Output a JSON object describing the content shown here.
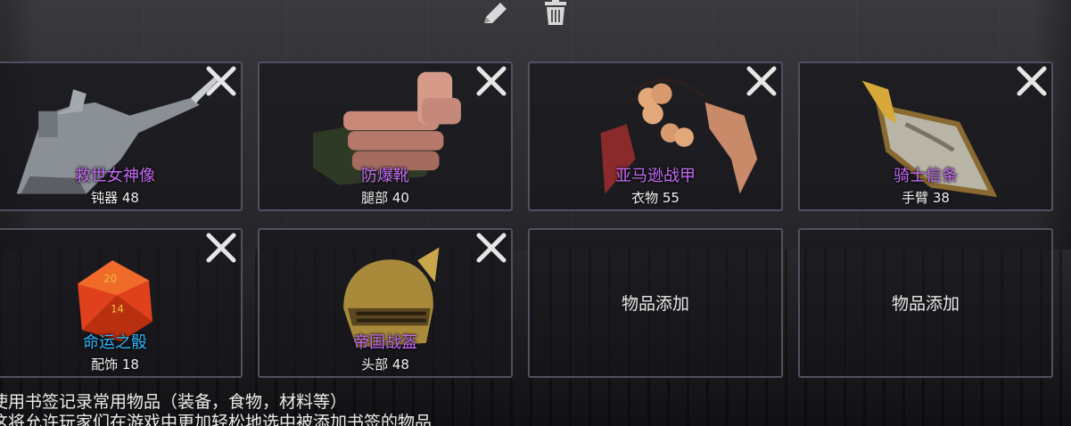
{
  "toolbar": {
    "edit_icon": "pencil-icon",
    "delete_icon": "trash-icon"
  },
  "slots": [
    {
      "name": "救世女神像",
      "stat": "钝器 48",
      "name_color": "#c46bf5",
      "icon": "goddess-statue-icon"
    },
    {
      "name": "防爆靴",
      "stat": "腿部 40",
      "name_color": "#c46bf5",
      "icon": "boots-icon"
    },
    {
      "name": "亚马逊战甲",
      "stat": "衣物 55",
      "name_color": "#c46bf5",
      "icon": "amazon-armor-icon"
    },
    {
      "name": "骑士信条",
      "stat": "手臂 38",
      "name_color": "#c46bf5",
      "icon": "knight-shield-icon"
    },
    {
      "name": "命运之骰",
      "stat": "配饰 18",
      "name_color": "#2fb8ff",
      "icon": "d20-dice-icon"
    },
    {
      "name": "帝国战盔",
      "stat": "头部 48",
      "name_color": "#c46bf5",
      "icon": "helmet-icon"
    },
    {
      "add_label": "物品添加"
    },
    {
      "add_label": "物品添加"
    }
  ],
  "footer": {
    "line1": "使用书签记录常用物品（装备，食物，材料等）",
    "line2": "这将允许玩家们在游戏中更加轻松地选中被添加书签的物品"
  }
}
